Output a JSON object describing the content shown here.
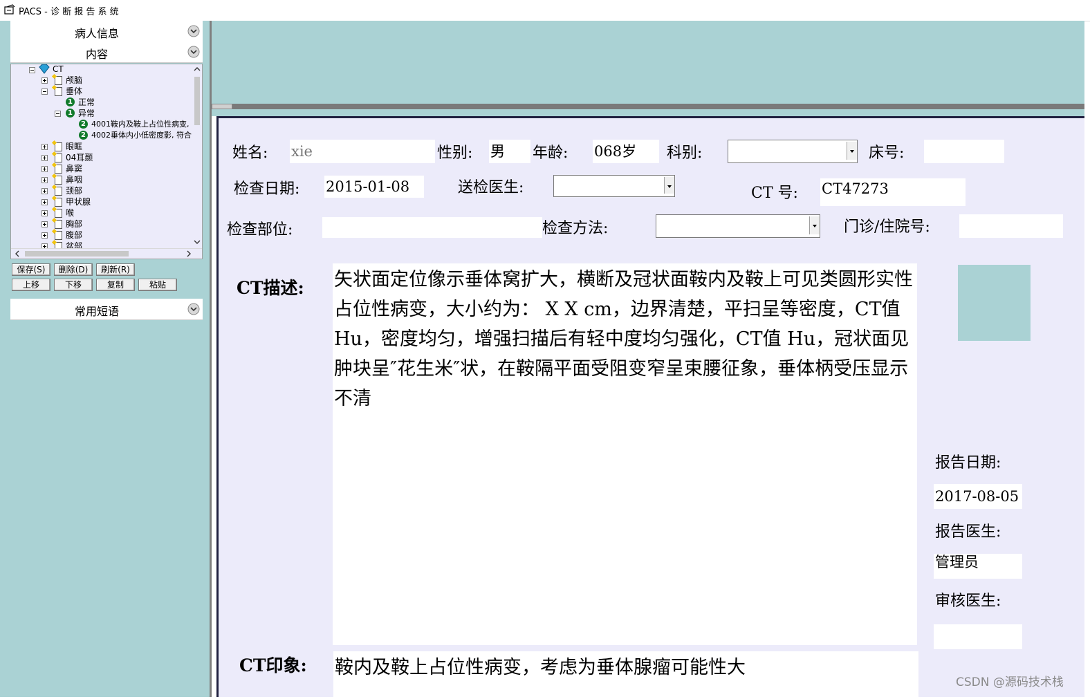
{
  "window": {
    "title": "PACS - 诊 断 报 告 系 统"
  },
  "sidebar": {
    "patient_info": "病人信息",
    "content": "内容",
    "common_phrases": "常用短语",
    "tree": {
      "root": "CT",
      "items": [
        "颅脑",
        "垂体",
        "正常",
        "异常",
        "4001鞍内及鞍上占位性病变,",
        "4002垂体内小低密度影, 符合",
        "眼眶",
        "04耳颞",
        "鼻窦",
        "鼻咽",
        "颈部",
        "甲状腺",
        "喉",
        "胸部",
        "腹部",
        "盆部"
      ],
      "badges": [
        "1",
        "1",
        "2",
        "2"
      ]
    },
    "buttons": {
      "save": "保存(S)",
      "delete": "删除(D)",
      "refresh": "刷新(R)",
      "up": "上移",
      "down": "下移",
      "copy": "复制",
      "paste": "粘贴"
    }
  },
  "form": {
    "labels": {
      "name": "姓名:",
      "sex": "性别:",
      "age": "年龄:",
      "dept": "科别:",
      "bed": "床号:",
      "exam_date": "检查日期:",
      "ref_doctor": "送检医生:",
      "ct_no": "CT 号:",
      "exam_site": "检查部位:",
      "exam_method": "检查方法:",
      "outpatient": "门诊/住院号:",
      "ct_desc": "CT描述:",
      "ct_impression": "CT印象:",
      "report_date": "报告日期:",
      "report_doctor": "报告医生:",
      "review_doctor": "审核医生:"
    },
    "values": {
      "name": "xie",
      "sex": "男",
      "age": "068岁",
      "exam_date": "2015-01-08",
      "ct_no": "CT47273",
      "report_date": "2017-08-05",
      "report_doctor": "管理员"
    },
    "ct_description": "矢状面定位像示垂体窝扩大，横断及冠状面鞍内及鞍上可见类圆形实性占位性病变，大小约为： X  X  cm，边界清楚，平扫呈等密度，CT值  Hu，密度均匀，增强扫描后有轻中度均匀强化，CT值  Hu，冠状面见肿块呈″花生米″状，在鞍隔平面受阻变窄呈束腰征象，垂体柄受压显示不清",
    "ct_impression": "鞍内及鞍上占位性病变，考虑为垂体腺瘤可能性大"
  },
  "watermark": "CSDN @源码技术栈",
  "colors": {
    "panel_bg": "#aad2d4",
    "form_bg": "#ecebfa",
    "tree_bg": "#ecebfa",
    "badge": "#117a2b"
  }
}
